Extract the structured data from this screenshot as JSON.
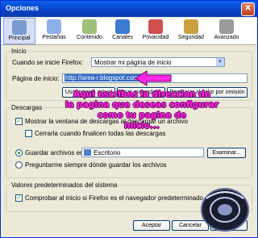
{
  "window": {
    "title": "Opciones",
    "close_glyph": "✕"
  },
  "toolbar": {
    "items": [
      {
        "label": "Principal",
        "icon": "home-icon",
        "color": "#7a9bd0"
      },
      {
        "label": "Pestañas",
        "icon": "tabs-icon",
        "color": "#8cb0e8"
      },
      {
        "label": "Contenido",
        "icon": "content-icon",
        "color": "#9fc07a"
      },
      {
        "label": "Canales",
        "icon": "feeds-icon",
        "color": "#3b7bd0"
      },
      {
        "label": "Privacidad",
        "icon": "privacy-icon",
        "color": "#d05050"
      },
      {
        "label": "Seguridad",
        "icon": "lock-icon",
        "color": "#c8a040"
      },
      {
        "label": "Avanzado",
        "icon": "gear-icon",
        "color": "#9a9a9a"
      }
    ],
    "selected": "Principal"
  },
  "inicio": {
    "legend": "Inicio",
    "startup_label": "Cuando se inicie Firefox:",
    "startup_value": "Mostrar mi página de inicio",
    "homepage_label": "Página de inicio:",
    "homepage_value": "http://area-r.blogspot.com/",
    "buttons": [
      "Usar página actual",
      "Usar marcador...",
      "Restaurar al valor por omisión"
    ]
  },
  "descargas": {
    "legend": "Descargas",
    "show_window_label": "Mostrar la ventana de descargas al descargar un archivo",
    "show_window_checked": true,
    "close_when_done_label": "Cerrarla cuando finalicen todas las descargas",
    "close_when_done_checked": false,
    "save_to_label": "Guardar archivos en",
    "save_to_folder": "Escritorio",
    "browse_button": "Examinar...",
    "ask_label": "Preguntarme siempre dónde guardar los archivos",
    "save_selected": true
  },
  "sistema": {
    "legend": "Valores predeterminados del sistema",
    "check_default_label": "Comprobar al inicio si Firefox es el navegador predeterminado",
    "check_default_checked": true
  },
  "footer": {
    "ok": "Aceptar",
    "cancel": "Cancelar",
    "help": "Ayuda"
  },
  "overlay": {
    "lines": [
      "Aqui escribes la direccion de",
      "la pagina que deseas configurar",
      "como tu pagina de",
      "inicio..."
    ],
    "color": "#ff26e6"
  }
}
